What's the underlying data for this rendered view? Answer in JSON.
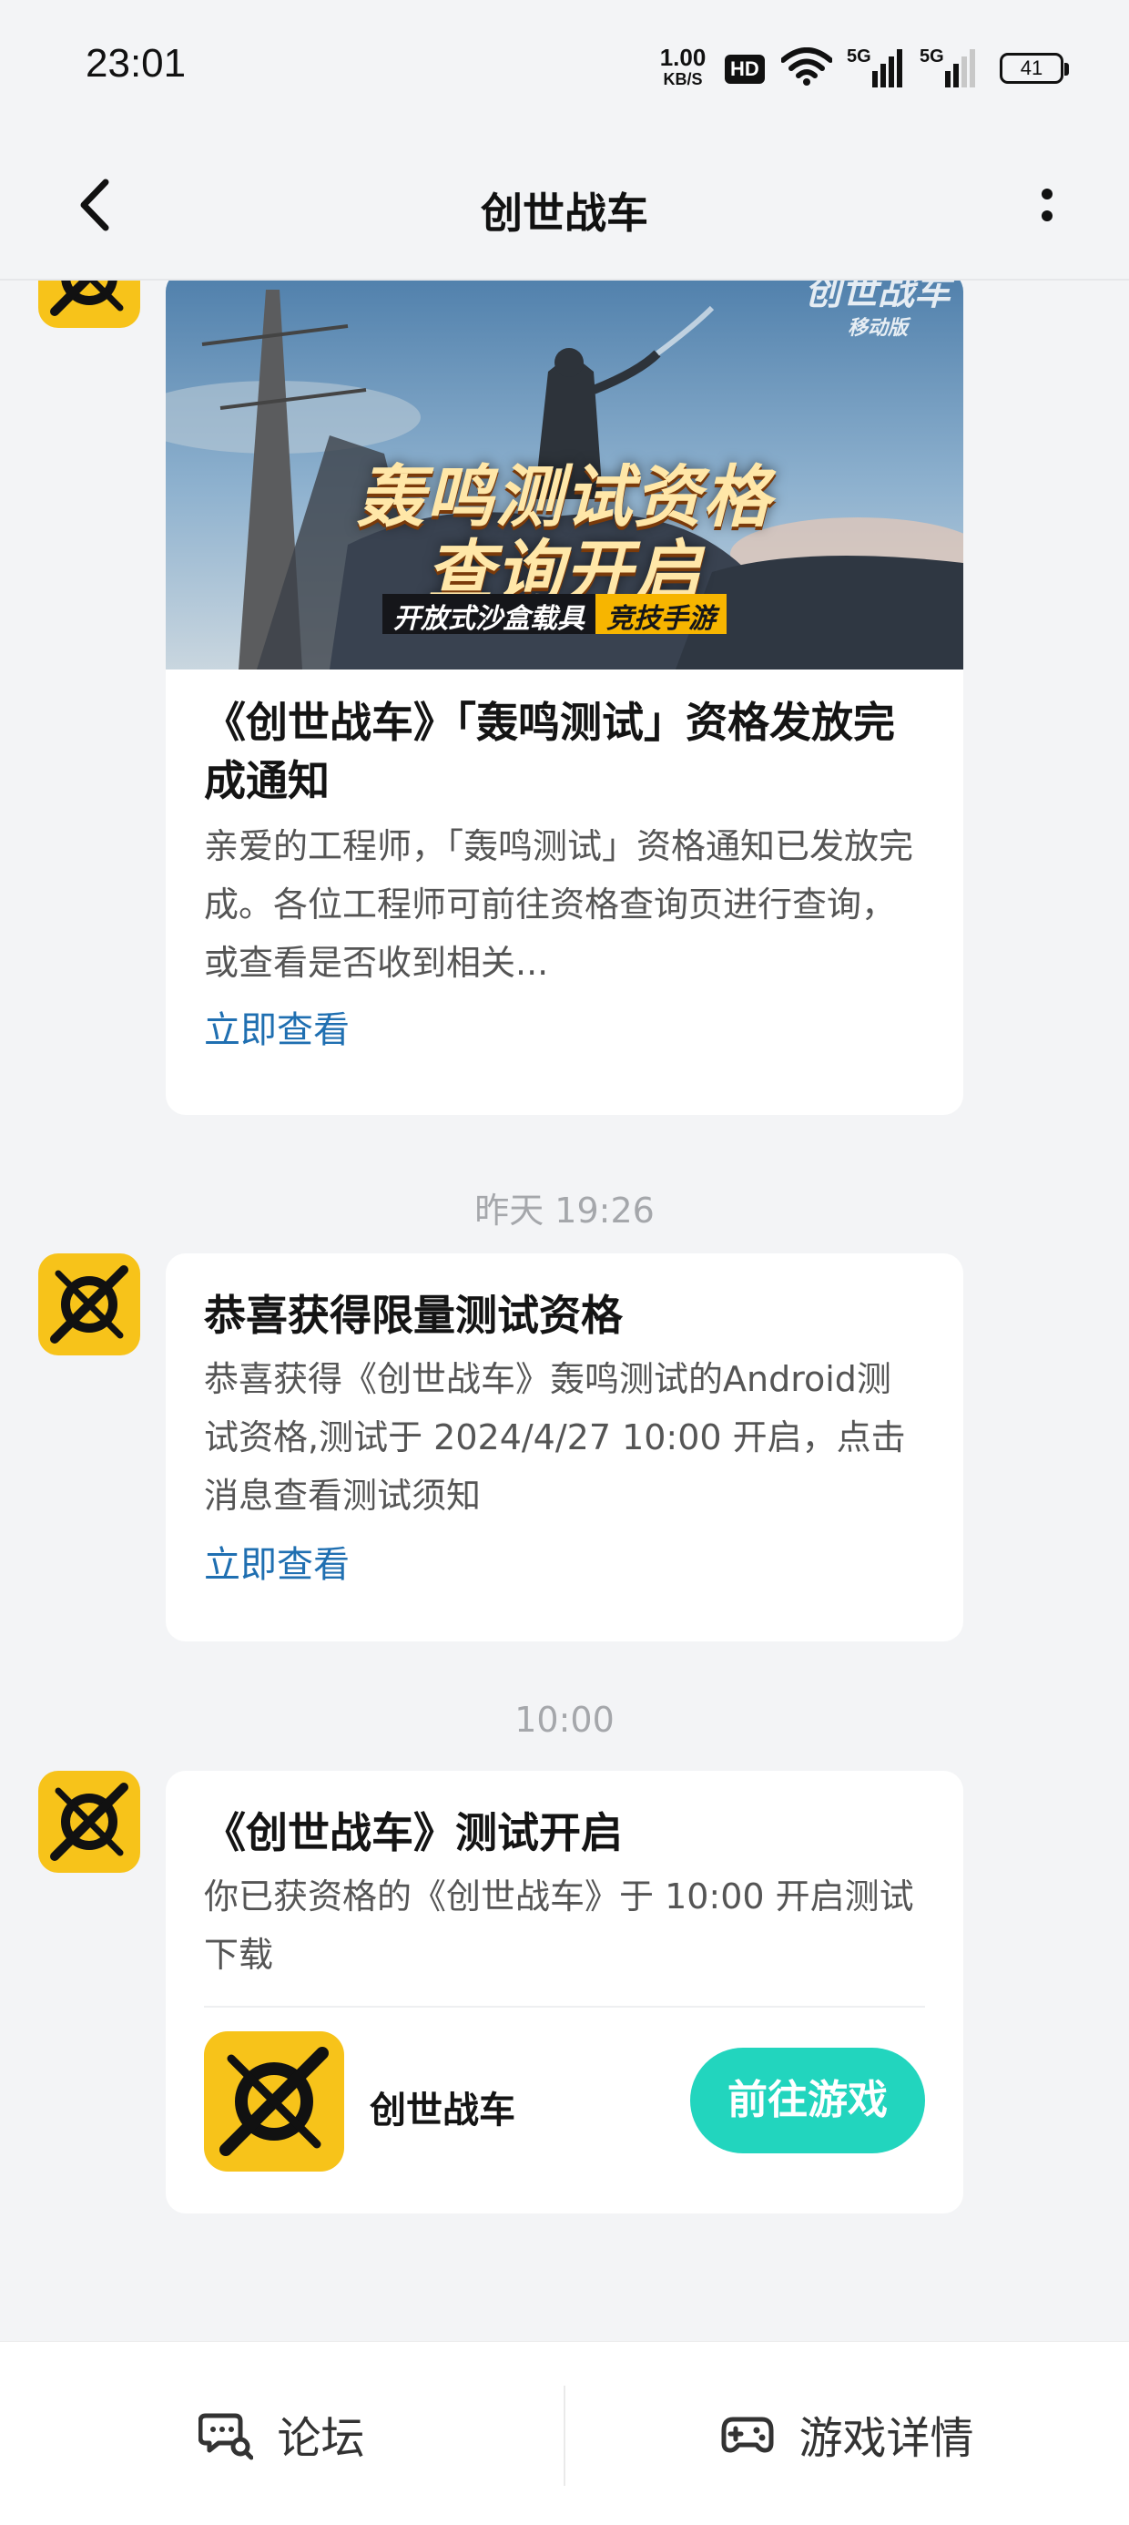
{
  "status_bar": {
    "time": "23:01",
    "net_speed_value": "1.00",
    "net_speed_unit": "KB/S",
    "hd_label": "HD",
    "signal_1_label": "5G",
    "signal_2_label": "5G",
    "battery_level": "41"
  },
  "nav": {
    "title": "创世战车",
    "icons": {
      "back": "back-chevron-icon",
      "more": "more-vertical-icon"
    }
  },
  "messages": [
    {
      "banner": {
        "headline_line1": "轰鸣测试资格",
        "headline_line2": "查询开启",
        "tagline_left": "开放式沙盒载具",
        "tagline_right": "竞技手游",
        "logo_text": "创世战车",
        "logo_sub": "移动版"
      },
      "title": "《创世战车》「轰鸣测试」资格发放完成通知",
      "desc": "亲爱的工程师，「轰鸣测试」资格通知已发放完成。各位工程师可前往资格查询页进行查询，或查看是否收到相关...",
      "link": "立即查看"
    },
    {
      "timestamp": "昨天  19:26",
      "title": "恭喜获得限量测试资格",
      "desc": "恭喜获得《创世战车》轰鸣测试的Android测试资格,测试于 2024/4/27 10:00 开启，点击消息查看测试须知",
      "link": "立即查看"
    },
    {
      "timestamp": "10:00",
      "title": "《创世战车》测试开启",
      "desc": "你已获资格的《创世战车》于 10:00 开启测试下载",
      "game_name": "创世战车",
      "button": "前往游戏"
    }
  ],
  "bottom_bar": {
    "forum_label": "论坛",
    "details_label": "游戏详情",
    "icons": {
      "forum": "forum-chat-icon",
      "details": "gamepad-icon"
    }
  },
  "colors": {
    "background": "#f3f4f6",
    "link": "#1f6fb1",
    "accent_button": "#22d5be",
    "avatar_bg": "#f7c31a"
  }
}
